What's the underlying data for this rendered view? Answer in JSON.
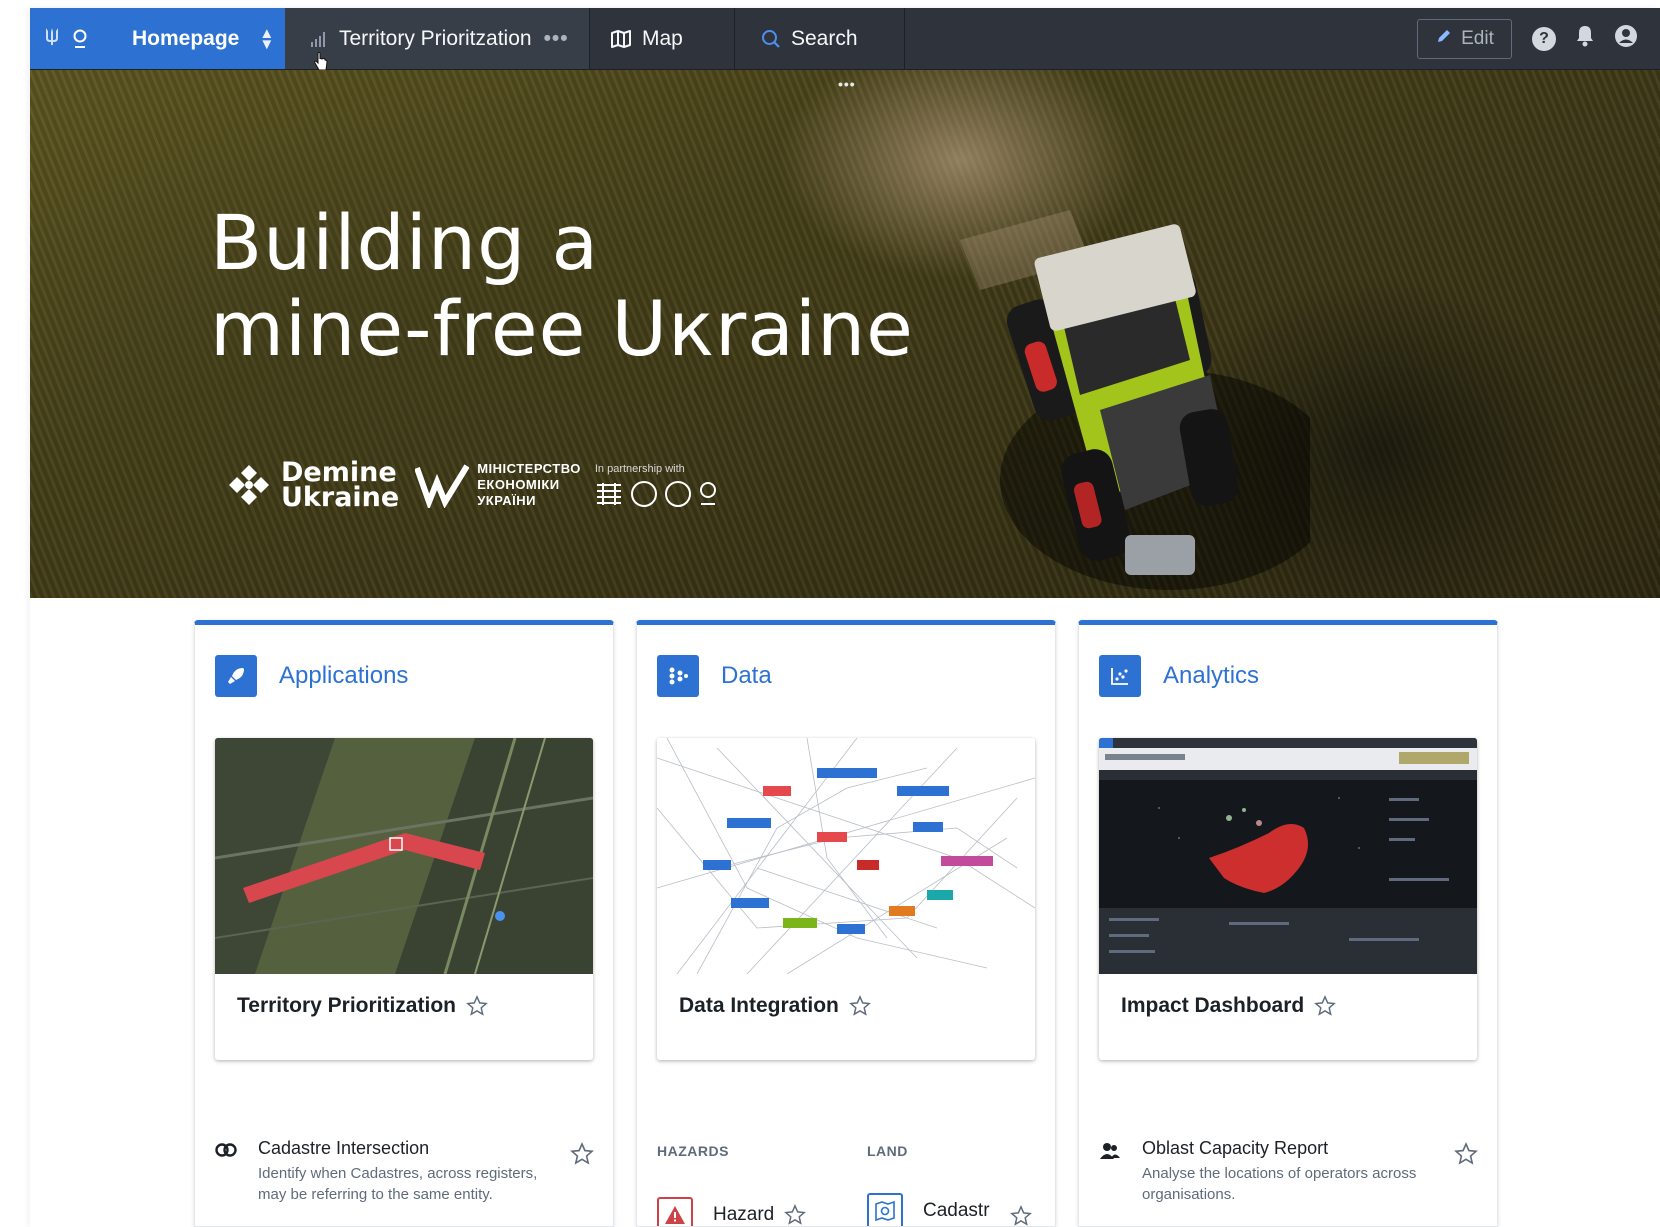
{
  "nav": {
    "home_label": "Homepage",
    "tabs": [
      {
        "label": "Territory Prioritzation",
        "more": "•••"
      },
      {
        "label": "Map"
      },
      {
        "label": "Search"
      }
    ],
    "edit_label": "Edit"
  },
  "hero": {
    "title_line1": "Building a",
    "title_line2": "mine-free Uкraine",
    "demine_line1": "Demine",
    "demine_line2": "Ukraine",
    "ministry_line1": "МІНІСТЕРСТВО",
    "ministry_line2": "ЕКОНОМІКИ",
    "ministry_line3": "УКРАЇНИ",
    "partner_caption": "In partnership with",
    "more": "•••"
  },
  "cards": [
    {
      "title": "Applications",
      "tile_label": "Territory Prioritization",
      "resource": {
        "name": "Cadastre Intersection",
        "desc": "Identify when Cadastres, across registers, may be referring to the same entity."
      }
    },
    {
      "title": "Data",
      "tile_label": "Data Integration",
      "sections": [
        "HAZARDS",
        "LAND"
      ],
      "items": [
        {
          "name": "Hazard",
          "color": "#cd4246"
        },
        {
          "name": "Cadastr",
          "color": "#2d72d2"
        }
      ]
    },
    {
      "title": "Analytics",
      "tile_label": "Impact Dashboard",
      "resource": {
        "name": "Oblast Capacity Report",
        "desc": "Analyse the locations of operators across organisations."
      }
    }
  ],
  "colors": {
    "accent": "#2d72d2",
    "nav_bg": "#2f343c",
    "danger": "#cd4246"
  }
}
